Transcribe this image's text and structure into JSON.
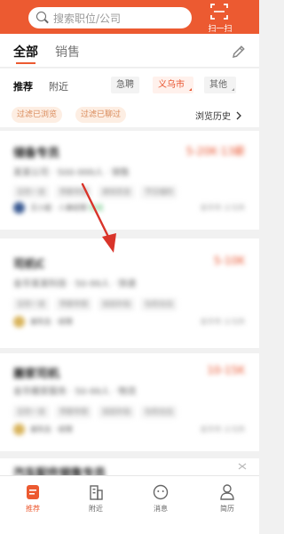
{
  "header": {
    "search_placeholder": "搜索职位/公司",
    "scan_label": "扫一扫",
    "icons": {
      "search": "search-icon",
      "scan": "scan-icon"
    }
  },
  "tabs": [
    {
      "label": "全部",
      "active": true
    },
    {
      "label": "销售",
      "active": false
    }
  ],
  "filters": {
    "tabs": [
      {
        "label": "推荐",
        "active": true
      },
      {
        "label": "附近",
        "active": false
      }
    ],
    "chips": [
      {
        "label": "急聘"
      },
      {
        "label": "义乌市"
      },
      {
        "label": "其他"
      }
    ]
  },
  "quick": {
    "pills": [
      "过滤已浏览",
      "过滤已聊过"
    ],
    "history_label": "浏览历史"
  },
  "jobs": [
    {
      "title": "储备专员",
      "salary": "5-20K·13薪",
      "company": "某某公司 · 500-999人 · 销售",
      "tags": [
        "五险一金",
        "带薪年假",
        "绩效奖金",
        "节日福利"
      ],
      "recruiter": "王小姐 · 人事经理",
      "status": "在线",
      "location": "金华市 义乌市"
    },
    {
      "title": "司机C",
      "salary": "5-10K",
      "company": "金华某某科技 · 50-99人 · 快递",
      "tags": [
        "五险一金",
        "带薪年假",
        "加班补贴",
        "包吃包住"
      ],
      "recruiter": "谢先生 · 经理",
      "status": "",
      "location": "金华市 义乌市"
    },
    {
      "title": "搬家司机",
      "salary": "10-15K",
      "company": "金华搬家服务 · 50-99人 · 物流",
      "tags": [
        "五险一金",
        "带薪年假",
        "加班补贴",
        "包吃包住"
      ],
      "recruiter": "谢先生 · 经理",
      "status": "",
      "location": "金华市 义乌市"
    },
    {
      "title": "汽车配件销售专员",
      "salary": "",
      "company": "",
      "tags": [],
      "recruiter": "",
      "status": "",
      "location": ""
    }
  ],
  "bottom_nav": [
    {
      "label": "推荐",
      "icon": "recommend-icon",
      "active": true
    },
    {
      "label": "附近",
      "icon": "nearby-icon",
      "active": false
    },
    {
      "label": "消息",
      "icon": "message-icon",
      "active": false
    },
    {
      "label": "简历",
      "icon": "resume-icon",
      "active": false
    }
  ],
  "colors": {
    "brand": "#ec5a31",
    "salary": "#e8512b",
    "arrow": "#d9342a"
  }
}
